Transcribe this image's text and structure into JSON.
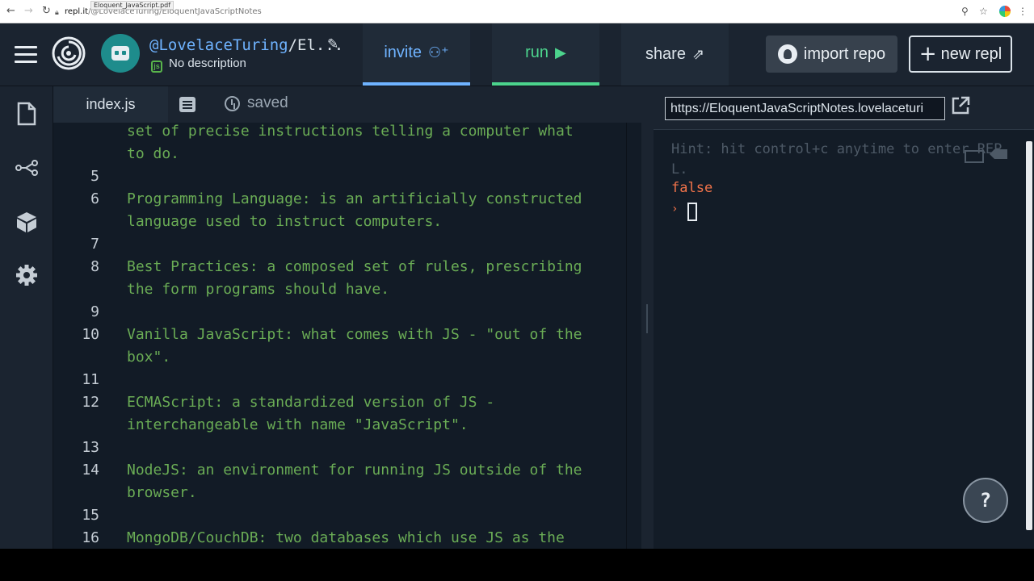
{
  "browser": {
    "tooltip": "Eloquent_JavaScript.pdf",
    "url_host": "repl.it",
    "url_path": "/@LovelaceTuring/EloquentJavaScriptNotes"
  },
  "header": {
    "username": "@LovelaceTuring",
    "repl_title_rest": "/El...",
    "description": "No description",
    "invite_label": "invite",
    "run_label": "run",
    "share_label": "share",
    "import_label": "import repo",
    "new_repl_label": "new repl"
  },
  "editor": {
    "tab_label": "index.js",
    "saved_label": "saved",
    "lines": [
      {
        "num": "",
        "text": "set of precise instructions telling a computer what"
      },
      {
        "num": "",
        "text": "to do."
      },
      {
        "num": "5",
        "text": ""
      },
      {
        "num": "6",
        "text": "Programming Language: is an artificially constructed"
      },
      {
        "num": "",
        "text": "language used to instruct computers."
      },
      {
        "num": "7",
        "text": ""
      },
      {
        "num": "8",
        "text": "Best Practices: a composed set of rules, prescribing"
      },
      {
        "num": "",
        "text": "the form programs should have."
      },
      {
        "num": "9",
        "text": ""
      },
      {
        "num": "10",
        "text": "Vanilla JavaScript: what comes with JS - \"out of the"
      },
      {
        "num": "",
        "text": "box\"."
      },
      {
        "num": "11",
        "text": ""
      },
      {
        "num": "12",
        "text": "ECMAScript: a standardized version of JS -"
      },
      {
        "num": "",
        "text": "interchangeable with name \"JavaScript\"."
      },
      {
        "num": "13",
        "text": ""
      },
      {
        "num": "14",
        "text": "NodeJS: an environment for running JS outside of the"
      },
      {
        "num": "",
        "text": "browser."
      },
      {
        "num": "15",
        "text": ""
      },
      {
        "num": "16",
        "text": "MongoDB/CouchDB: two databases which use JS as the"
      }
    ]
  },
  "output": {
    "url": "https://EloquentJavaScriptNotes.lovelaceturi",
    "hint": "Hint: hit control+c anytime to enter REPL.",
    "result": "false",
    "help_label": "?"
  },
  "colors": {
    "code_text": "#6aac55",
    "accent_blue": "#6fb3ff",
    "accent_green": "#4cd48d",
    "output_red": "#f2734a"
  }
}
